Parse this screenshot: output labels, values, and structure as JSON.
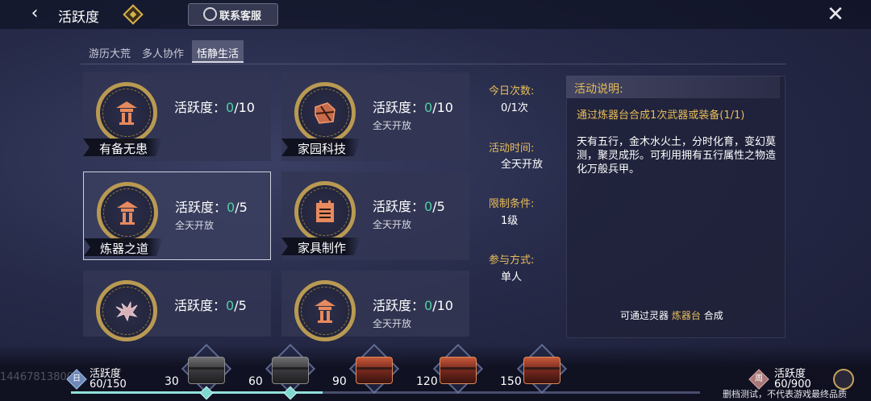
{
  "header": {
    "title": "活跃度",
    "support_label": "联系客服"
  },
  "tabs": [
    {
      "label": "游历大荒",
      "active": false
    },
    {
      "label": "多人协作",
      "active": false
    },
    {
      "label": "恬静生活",
      "active": true
    }
  ],
  "activities": [
    {
      "name": "有备无患",
      "score_label": "活跃度：",
      "current": "0",
      "max": "/10",
      "open_text": "",
      "icon": "lantern-icon",
      "selected": false
    },
    {
      "name": "家园科技",
      "score_label": "活跃度：",
      "current": "0",
      "max": "/10",
      "open_text": "全天开放",
      "icon": "crate-icon",
      "selected": false
    },
    {
      "name": "炼器之道",
      "score_label": "活跃度：",
      "current": "0",
      "max": "/5",
      "open_text": "全天开放",
      "icon": "lantern-icon",
      "selected": true
    },
    {
      "name": "家具制作",
      "score_label": "活跃度：",
      "current": "0",
      "max": "/5",
      "open_text": "全天开放",
      "icon": "cabinet-icon",
      "selected": false
    },
    {
      "name": "",
      "score_label": "活跃度：",
      "current": "0",
      "max": "/5",
      "open_text": "",
      "icon": "creature-icon",
      "selected": false
    },
    {
      "name": "",
      "score_label": "活跃度：",
      "current": "0",
      "max": "/10",
      "open_text": "全天开放",
      "icon": "lantern-icon",
      "selected": false
    }
  ],
  "info": {
    "daily_count_label": "今日次数:",
    "daily_count_value": "0/1次",
    "time_label": "活动时间:",
    "time_value": "全天开放",
    "limit_label": "限制条件:",
    "limit_value": "1级",
    "mode_label": "参与方式:",
    "mode_value": "单人"
  },
  "description": {
    "title": "活动说明:",
    "task": "通过炼器台合成1次武器或装备(1/1)",
    "body": "天有五行，金木水火土，分时化育，变幻莫测，聚灵成形。可利用拥有五行属性之物造化万般兵甲。",
    "foot_prefix": "可通过灵器",
    "foot_highlight": "炼器台",
    "foot_suffix": "合成"
  },
  "progress": {
    "watermark": "144678138005",
    "day_icon": "日",
    "day_label": "活跃度",
    "day_value": "60/150",
    "day_fraction": 0.4,
    "week_icon": "周",
    "week_label": "活跃度",
    "week_value": "60/900",
    "milestones": [
      {
        "value": "30",
        "chest": "dark",
        "reached": true
      },
      {
        "value": "60",
        "chest": "dark",
        "reached": true
      },
      {
        "value": "90",
        "chest": "red",
        "reached": false
      },
      {
        "value": "120",
        "chest": "red",
        "reached": false
      },
      {
        "value": "150",
        "chest": "red",
        "reached": false
      }
    ],
    "disclaimer": "删档测试，不代表游戏最终品质"
  },
  "colors": {
    "accent_gold": "#e8bd5a",
    "score_green": "#4fd0a6",
    "ring_gold": "#b99a52"
  }
}
